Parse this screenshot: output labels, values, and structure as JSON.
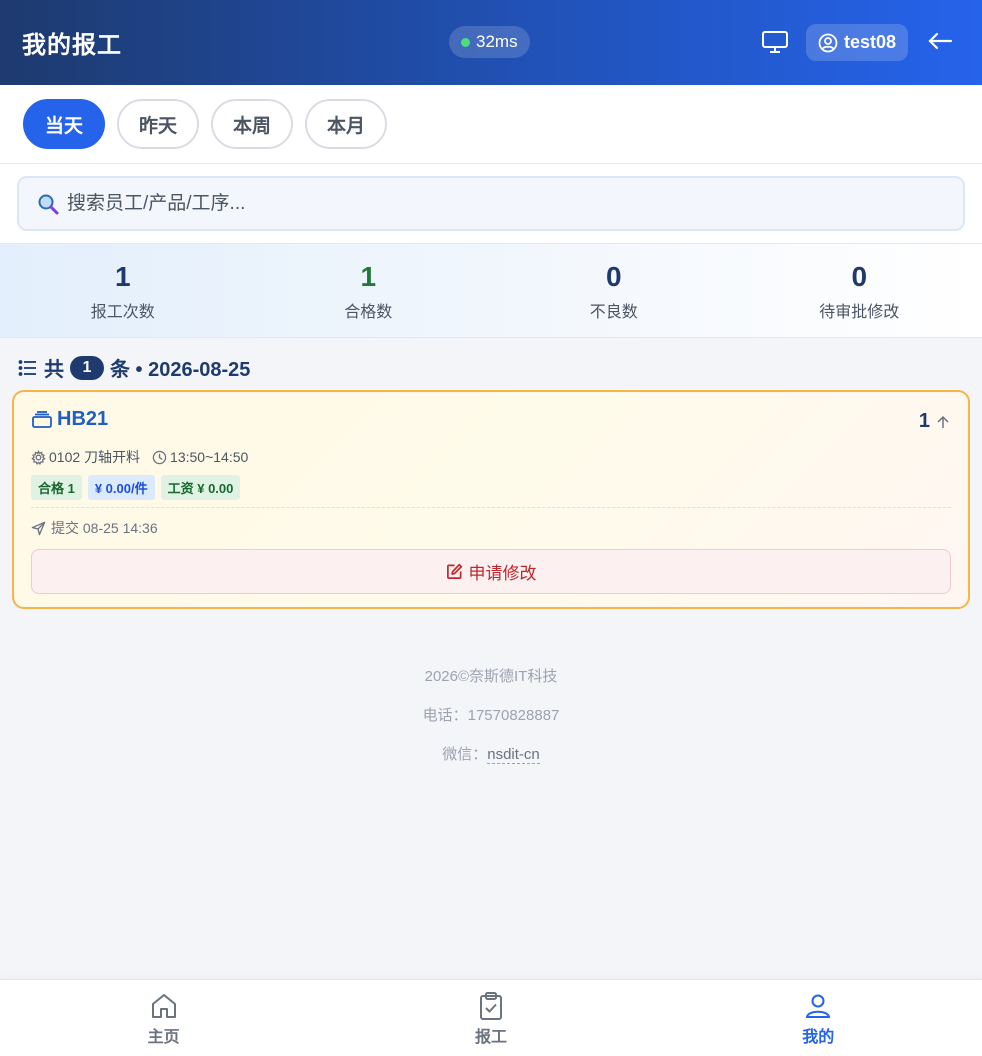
{
  "header": {
    "title": "我的报工",
    "latency": "32ms",
    "username": "test08"
  },
  "tabs": [
    {
      "label": "当天",
      "active": true
    },
    {
      "label": "昨天",
      "active": false
    },
    {
      "label": "本周",
      "active": false
    },
    {
      "label": "本月",
      "active": false
    }
  ],
  "search": {
    "placeholder": "搜索员工/产品/工序...",
    "value": ""
  },
  "stats": [
    {
      "value": "1",
      "label": "报工次数"
    },
    {
      "value": "1",
      "label": "合格数"
    },
    {
      "value": "0",
      "label": "不良数"
    },
    {
      "value": "0",
      "label": "待审批修改"
    }
  ],
  "list": {
    "prefix": "共",
    "count": "1",
    "suffix": "条 • 2026-08-25"
  },
  "record": {
    "code": "HB21",
    "quantity": "1",
    "process": "0102 刀轴开料",
    "time_range": "13:50~14:50",
    "tags": {
      "qualified": "合格 1",
      "unit_price": "¥ 0.00/件",
      "wage": "工资 ¥ 0.00"
    },
    "submitted": "提交 08-25 14:36",
    "modify_label": "申请修改"
  },
  "footer": {
    "copyright": "2026©奈斯德IT科技",
    "phone": "电话：17570828887",
    "wechat_label": "微信：",
    "wechat_id": "nsdit-cn"
  },
  "bottom_nav": [
    {
      "label": "主页",
      "icon": "home-icon",
      "active": false
    },
    {
      "label": "报工",
      "icon": "clipboard-check-icon",
      "active": false
    },
    {
      "label": "我的",
      "icon": "user-icon",
      "active": true
    }
  ],
  "colors": {
    "primary": "#2563eb",
    "header_dark": "#1e3a6e",
    "card_border": "#f5b54a",
    "danger": "#c0272d"
  }
}
